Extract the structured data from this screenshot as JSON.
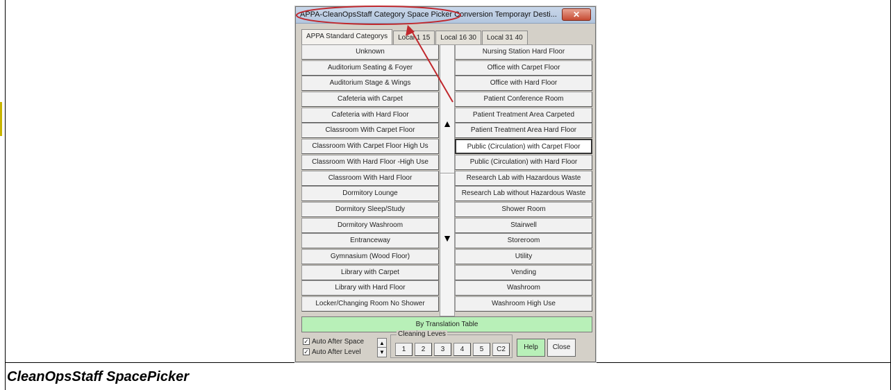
{
  "window": {
    "title": "APPA-CleanOpsStaff Category Space Picker  Conversion Temporayr Desti...",
    "close_glyph": "✕"
  },
  "tabs": [
    {
      "label": "APPA Standard Categorys",
      "active": true
    },
    {
      "label": "Local 1 15",
      "active": false
    },
    {
      "label": "Local 16 30",
      "active": false
    },
    {
      "label": "Local 31 40",
      "active": false
    }
  ],
  "left_categories": [
    "Unknown",
    "Auditorium Seating & Foyer",
    "Auditorium Stage & Wings",
    "Cafeteria with Carpet",
    "Cafeteria with Hard Floor",
    "Classroom With Carpet Floor",
    "Classroom With Carpet Floor  High Us",
    "Classroom With Hard Floor -High Use",
    "Classroom With Hard Floor",
    "Dormitory Lounge",
    "Dormitory Sleep/Study",
    "Dormitory Washroom",
    "Entranceway",
    "Gymnasium (Wood Floor)",
    "Library with Carpet",
    "Library with Hard Floor",
    "Locker/Changing Room  No Shower"
  ],
  "right_categories": [
    "Nursing Station  Hard Floor",
    "Office with Carpet Floor",
    "Office with Hard Floor",
    "Patient Conference Room",
    "Patient Treatment Area  Carpeted",
    "Patient Treatment Area  Hard Floor",
    "Public (Circulation) with Carpet Floor",
    "Public (Circulation) with Hard Floor",
    "Research Lab with Hazardous Waste",
    "Research Lab without Hazardous Waste",
    "Shower Room",
    "Stairwell",
    "Storeroom",
    "Utility",
    "Vending",
    "Washroom",
    "Washroom High Use"
  ],
  "selected_right_index": 6,
  "scroll": {
    "up_glyph": "▲",
    "down_glyph": "▼"
  },
  "translation_button": "By Translation Table",
  "options": {
    "auto_after_space": {
      "label": "Auto After Space",
      "checked": true
    },
    "auto_after_level": {
      "label": "Auto After Level",
      "checked": true
    },
    "check_glyph": "✓",
    "spin_up": "▲",
    "spin_down": "▼"
  },
  "cleaning_levels": {
    "legend": "Cleaning Leves",
    "buttons": [
      "1",
      "2",
      "3",
      "4",
      "5",
      "C2"
    ]
  },
  "help_label": "Help",
  "close_label": "Close",
  "caption": "CleanOpsStaff SpacePicker",
  "colors": {
    "annotation": "#c0282d",
    "green_button": "#b8f0b8"
  }
}
